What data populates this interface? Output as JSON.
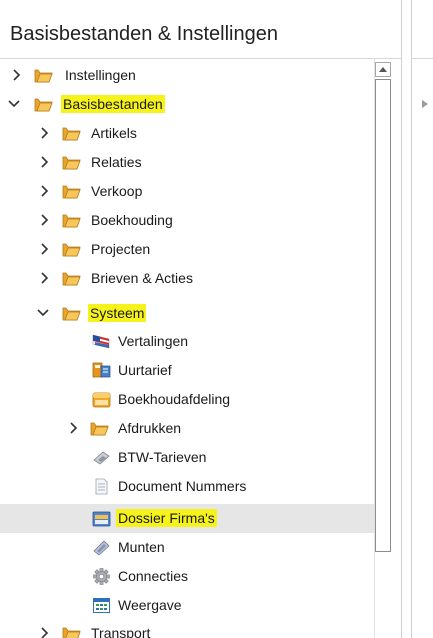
{
  "panel": {
    "title": "Basisbestanden & Instellingen"
  },
  "tree": {
    "items": [
      {
        "label": "Instellingen",
        "icon": "folder-icon",
        "expanded": false,
        "highlighted": false
      },
      {
        "label": "Basisbestanden",
        "icon": "folder-icon",
        "expanded": true,
        "highlighted": true
      },
      {
        "label": "Artikels",
        "icon": "folder-icon",
        "expanded": false,
        "highlighted": false
      },
      {
        "label": "Relaties",
        "icon": "folder-icon",
        "expanded": false,
        "highlighted": false
      },
      {
        "label": "Verkoop",
        "icon": "folder-icon",
        "expanded": false,
        "highlighted": false
      },
      {
        "label": "Boekhouding",
        "icon": "folder-icon",
        "expanded": false,
        "highlighted": false
      },
      {
        "label": "Projecten",
        "icon": "folder-icon",
        "expanded": false,
        "highlighted": false
      },
      {
        "label": "Brieven & Acties",
        "icon": "folder-icon",
        "expanded": false,
        "highlighted": false
      },
      {
        "label": "Systeem",
        "icon": "folder-icon",
        "expanded": true,
        "highlighted": true
      },
      {
        "label": "Vertalingen",
        "icon": "flag-icon",
        "highlighted": false
      },
      {
        "label": "Uurtarief",
        "icon": "rate-card-icon",
        "highlighted": false
      },
      {
        "label": "Boekhoudafdeling",
        "icon": "ledger-icon",
        "highlighted": false
      },
      {
        "label": "Afdrukken",
        "icon": "folder-icon",
        "expanded": false,
        "highlighted": false
      },
      {
        "label": "BTW-Tarieven",
        "icon": "calculator-icon",
        "highlighted": false
      },
      {
        "label": "Document Nummers",
        "icon": "document-icon",
        "highlighted": false
      },
      {
        "label": "Dossier Firma's",
        "icon": "company-file-icon",
        "highlighted": true,
        "selected": true
      },
      {
        "label": "Munten",
        "icon": "coin-icon",
        "highlighted": false
      },
      {
        "label": "Connecties",
        "icon": "gear-icon",
        "highlighted": false
      },
      {
        "label": "Weergave",
        "icon": "grid-icon",
        "highlighted": false
      },
      {
        "label": "Transport",
        "icon": "folder-icon",
        "expanded": false,
        "highlighted": false
      }
    ]
  },
  "colors": {
    "highlight": "#f6f21b",
    "selected_row": "#e6e6e6",
    "folder": "#f2b33d"
  }
}
